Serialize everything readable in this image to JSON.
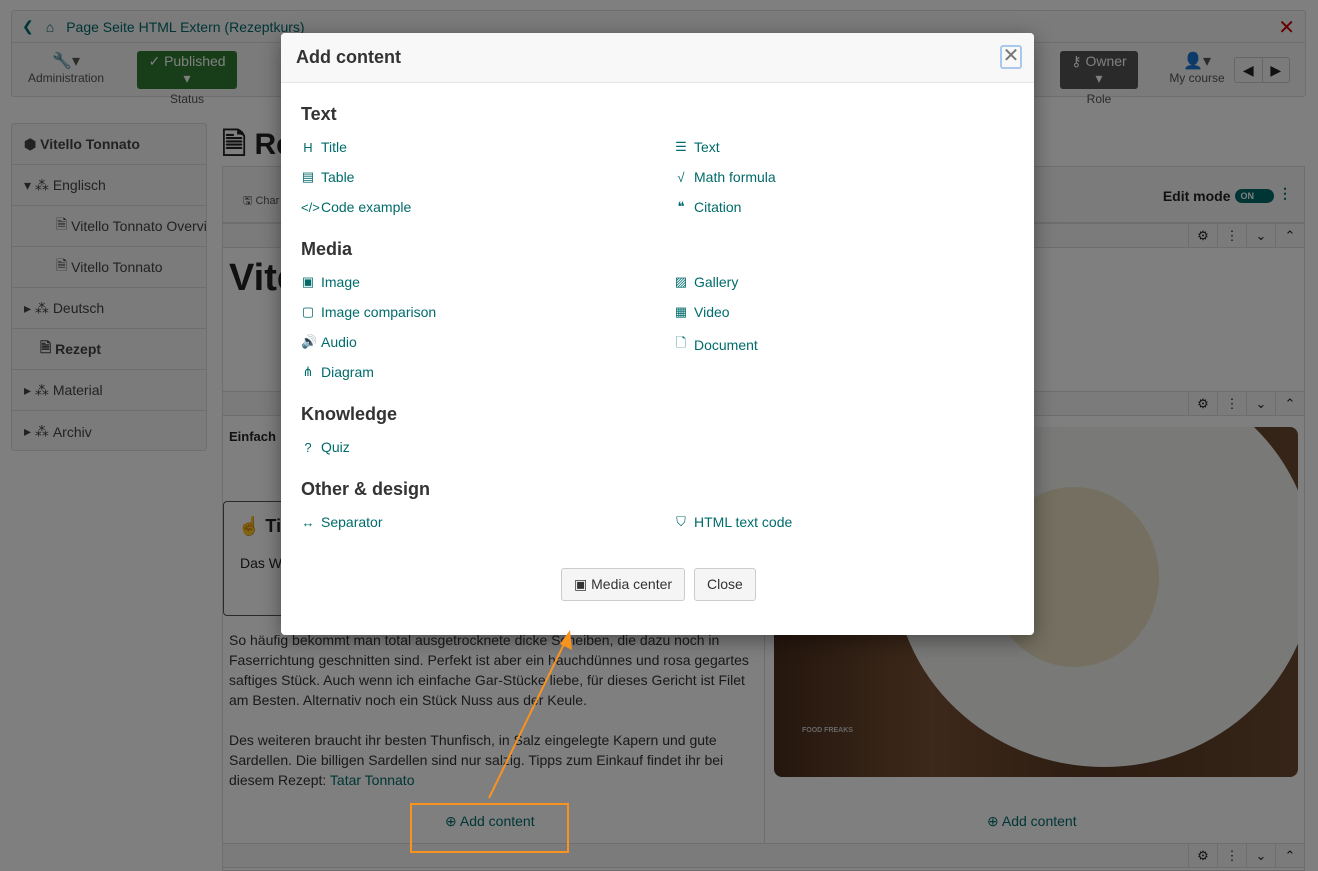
{
  "header": {
    "breadcrumb": "Page Seite HTML Extern (Rezeptkurs)",
    "admin_label": "Administration",
    "status_value": "Published",
    "status_label": "Status",
    "role_value": "Owner",
    "role_label": "Role",
    "my_course_label": "My course"
  },
  "sidebar": {
    "items": [
      {
        "label": "Vitello Tonnato"
      },
      {
        "label": "Englisch"
      },
      {
        "label": "Vitello Tonnato Overview"
      },
      {
        "label": "Vitello Tonnato"
      },
      {
        "label": "Deutsch"
      },
      {
        "label": "Rezept"
      },
      {
        "label": "Material"
      },
      {
        "label": "Archiv"
      }
    ]
  },
  "main": {
    "title_partial": "Re",
    "change_partial": "Char",
    "edit_mode_label": "Edit mode",
    "toggle_value": "ON",
    "heading_partial": "Vite",
    "einfach_partial": "Einfach",
    "tip_partial": "Ti",
    "tip_text_partial": "Das Wi",
    "paragraph1": "So häufig bekommt man total ausgetrocknete dicke Scheiben, die dazu noch in Faserrichtung geschnitten sind. Perfekt ist aber ein hauchdünnes und rosa gegartes saftiges Stück. Auch wenn ich einfache Gar-Stücke liebe, für dieses Gericht ist Filet am Besten. Alternativ noch ein Stück Nuss aus der Keule.",
    "paragraph2": "Des weiteren braucht ihr besten Thunfisch, in Salz eingelegte Kapern und gute Sardellen. Die billigen Sardellen sind nur salzig. Tipps zum Einkauf findet ihr bei diesem Rezept: ",
    "link": "Tatar Tonnato",
    "add_content_left": "Add content",
    "add_content_right": "Add content",
    "image_watermark": "FOOD FREAKS"
  },
  "modal": {
    "title": "Add content",
    "sections": {
      "text": "Text",
      "media": "Media",
      "knowledge": "Knowledge",
      "other": "Other & design"
    },
    "items": {
      "title": "Title",
      "text": "Text",
      "table": "Table",
      "math": "Math formula",
      "code": "Code example",
      "citation": "Citation",
      "image": "Image",
      "gallery": "Gallery",
      "image_comparison": "Image comparison",
      "video": "Video",
      "audio": "Audio",
      "document": "Document",
      "diagram": "Diagram",
      "quiz": "Quiz",
      "separator": "Separator",
      "html": "HTML text code"
    },
    "media_center": "Media center",
    "close": "Close"
  },
  "colors": {
    "accent": "#006b6b",
    "published": "#2e7d32",
    "annotation": "#f7931e"
  }
}
